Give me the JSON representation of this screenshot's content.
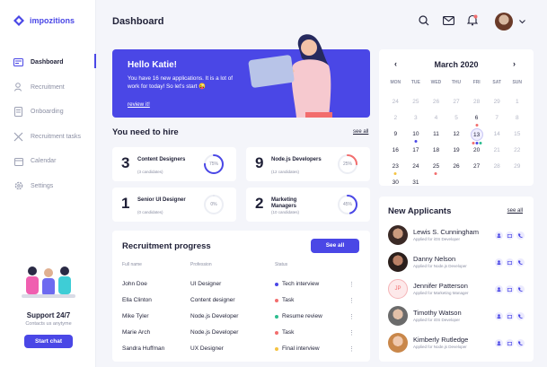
{
  "brand": {
    "name": "impozitions",
    "accent": "#4a47e6"
  },
  "sidebar": {
    "items": [
      {
        "label": "Dashboard",
        "icon": "dashboard-icon"
      },
      {
        "label": "Recruitment",
        "icon": "recruitment-icon"
      },
      {
        "label": "Onboarding",
        "icon": "onboarding-icon"
      },
      {
        "label": "Recruitment tasks",
        "icon": "tools-icon"
      },
      {
        "label": "Calendar",
        "icon": "calendar-icon"
      },
      {
        "label": "Settings",
        "icon": "gear-icon"
      }
    ],
    "support": {
      "title": "Support 24/7",
      "subtitle": "Contacts us anytyme",
      "button": "Start chat"
    }
  },
  "header": {
    "title": "Dashboard",
    "icons": [
      "search-icon",
      "mail-icon",
      "bell-icon",
      "chevron-down-icon"
    ]
  },
  "hero": {
    "title": "Hello Katie!",
    "text": "You have 16 new applications. It is a lot of work for today! So let's start 😜",
    "link": "review it!"
  },
  "hire": {
    "title": "You need to hire",
    "see_all": "see all",
    "cards": [
      {
        "count": "3",
        "role": "Content Designers",
        "sub": "(3 candidates)",
        "percent": 75,
        "percent_label": "75%",
        "color": "#4a47e6"
      },
      {
        "count": "9",
        "role": "Node.js Developers",
        "sub": "(12 candidates)",
        "percent": 25,
        "percent_label": "25%",
        "color": "#f26d6d"
      },
      {
        "count": "1",
        "role": "Senior UI Designer",
        "sub": "(0 candidates)",
        "percent": 0,
        "percent_label": "0%",
        "color": "#e3e5ee"
      },
      {
        "count": "2",
        "role": "Marketing Managers",
        "sub": "(10 candidates)",
        "percent": 45,
        "percent_label": "45%",
        "color": "#4a47e6"
      }
    ]
  },
  "progress": {
    "title": "Recruitment progress",
    "button": "See all",
    "columns": [
      "Full name",
      "Profession",
      "Status"
    ],
    "rows": [
      {
        "name": "John Doe",
        "profession": "UI Designer",
        "status": "Tech interview",
        "color": "#4a47e6"
      },
      {
        "name": "Ella Clinton",
        "profession": "Content designer",
        "status": "Task",
        "color": "#f26d6d"
      },
      {
        "name": "Mike Tyler",
        "profession": "Node.js Developer",
        "status": "Resume review",
        "color": "#2dbd8f"
      },
      {
        "name": "Marie Arch",
        "profession": "Node.js Developer",
        "status": "Task",
        "color": "#f26d6d"
      },
      {
        "name": "Sandra Huffman",
        "profession": "UX Designer",
        "status": "Final interview",
        "color": "#f5c342"
      }
    ]
  },
  "calendar": {
    "month": "March 2020",
    "weekdays": [
      "MON",
      "TUE",
      "WED",
      "THU",
      "FRI",
      "SAT",
      "SUN"
    ],
    "weeks": [
      [
        "24",
        "25",
        "26",
        "27",
        "28",
        "29",
        "1"
      ],
      [
        "2",
        "3",
        "4",
        "5",
        "6",
        "7",
        "8"
      ],
      [
        "9",
        "10",
        "11",
        "12",
        "13",
        "14",
        "15"
      ],
      [
        "16",
        "17",
        "18",
        "19",
        "20",
        "21",
        "22"
      ],
      [
        "23",
        "24",
        "25",
        "26",
        "27",
        "28",
        "29"
      ],
      [
        "30",
        "31"
      ]
    ]
  },
  "applicants": {
    "title": "New Applicants",
    "see_all": "see all",
    "items": [
      {
        "name": "Lewis S. Cunningham",
        "sub": "Applied for iOS Developer",
        "initials": ""
      },
      {
        "name": "Danny Nelson",
        "sub": "Applied for Node.js Developer",
        "initials": ""
      },
      {
        "name": "Jennifer Patterson",
        "sub": "Applied for Marketing Manager",
        "initials": "JP"
      },
      {
        "name": "Timothy Watson",
        "sub": "Applied for iOS Developer",
        "initials": ""
      },
      {
        "name": "Kimberly Rutledge",
        "sub": "Applied for Node.js Developer",
        "initials": ""
      }
    ]
  }
}
